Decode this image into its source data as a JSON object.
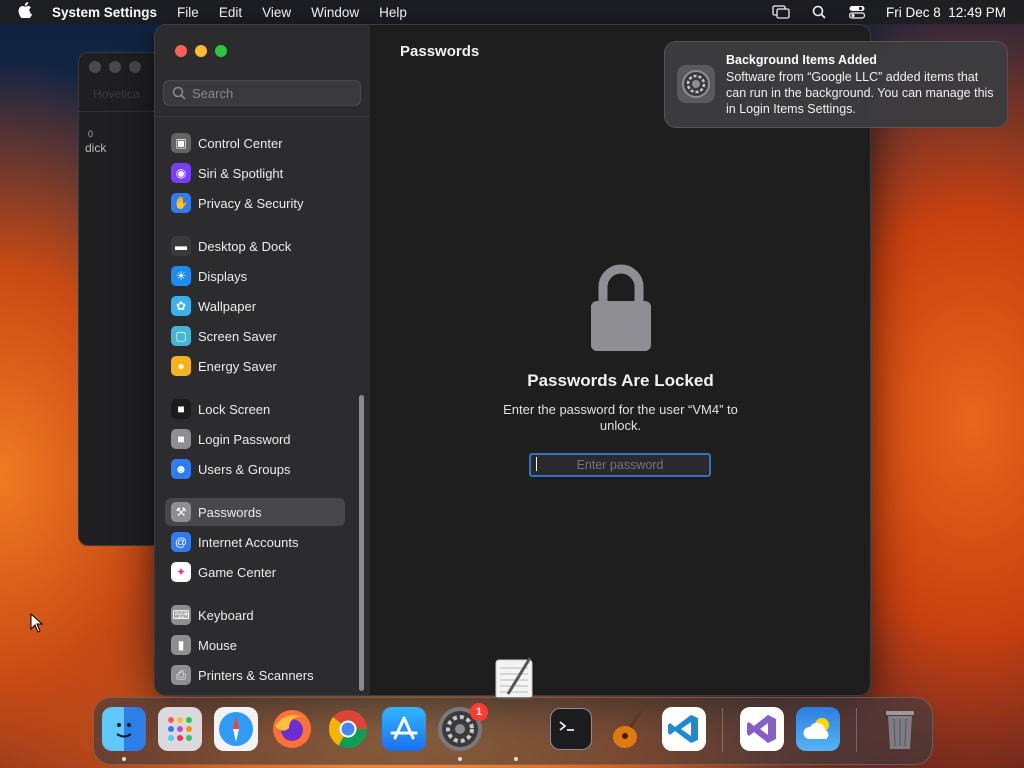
{
  "menubar": {
    "app_name": "System Settings",
    "menus": [
      "File",
      "Edit",
      "View",
      "Window",
      "Help"
    ],
    "clock": "Fri Dec 8  12:49 PM"
  },
  "background_window": {
    "title": "Hovetica",
    "cell_value": "0",
    "item_text": "dick"
  },
  "sidebar": {
    "search_placeholder": "Search",
    "items": [
      {
        "label": "Control Center",
        "icon": "control-center-icon",
        "color": "#636366"
      },
      {
        "label": "Siri & Spotlight",
        "icon": "siri-icon",
        "color": "#7a3cff"
      },
      {
        "label": "Privacy & Security",
        "icon": "hand-icon",
        "color": "#2f7bf6"
      },
      {
        "label": "Desktop & Dock",
        "icon": "dock-icon",
        "color": "#3a3a3c"
      },
      {
        "label": "Displays",
        "icon": "sun-icon",
        "color": "#1c8cf0"
      },
      {
        "label": "Wallpaper",
        "icon": "flower-icon",
        "color": "#3ab2ee"
      },
      {
        "label": "Screen Saver",
        "icon": "screen-saver-icon",
        "color": "#44b6d8"
      },
      {
        "label": "Energy Saver",
        "icon": "bulb-icon",
        "color": "#f5b31b"
      },
      {
        "label": "Lock Screen",
        "icon": "lock-icon",
        "color": "#1c1c1e"
      },
      {
        "label": "Login Password",
        "icon": "lock-icon",
        "color": "#8e8e93"
      },
      {
        "label": "Users & Groups",
        "icon": "users-icon",
        "color": "#2f7bf6"
      },
      {
        "label": "Passwords",
        "icon": "key-icon",
        "color": "#8e8e93",
        "selected": true
      },
      {
        "label": "Internet Accounts",
        "icon": "at-icon",
        "color": "#2f7bf6"
      },
      {
        "label": "Game Center",
        "icon": "game-center-icon",
        "color": "#ffffff"
      },
      {
        "label": "Keyboard",
        "icon": "keyboard-icon",
        "color": "#8e8e93"
      },
      {
        "label": "Mouse",
        "icon": "mouse-icon",
        "color": "#8e8e93"
      },
      {
        "label": "Printers & Scanners",
        "icon": "printer-icon",
        "color": "#8e8e93"
      }
    ]
  },
  "content": {
    "title": "Passwords",
    "locked_title": "Passwords Are Locked",
    "locked_message": "Enter the password for the user “VM4” to unlock.",
    "password_placeholder": "Enter password"
  },
  "notification": {
    "title": "Background Items Added",
    "body": "Software from “Google LLC” added items that can run in the background. You can manage this in Login Items Settings."
  },
  "dock": {
    "apps": [
      "Finder",
      "Launchpad",
      "Safari",
      "Firefox",
      "Chrome",
      "App Store",
      "System Settings",
      "Terminal",
      "GarageBand",
      "Visual Studio Code",
      "Visual Studio",
      "Weather",
      "Trash"
    ],
    "system_settings_badge": "1"
  }
}
